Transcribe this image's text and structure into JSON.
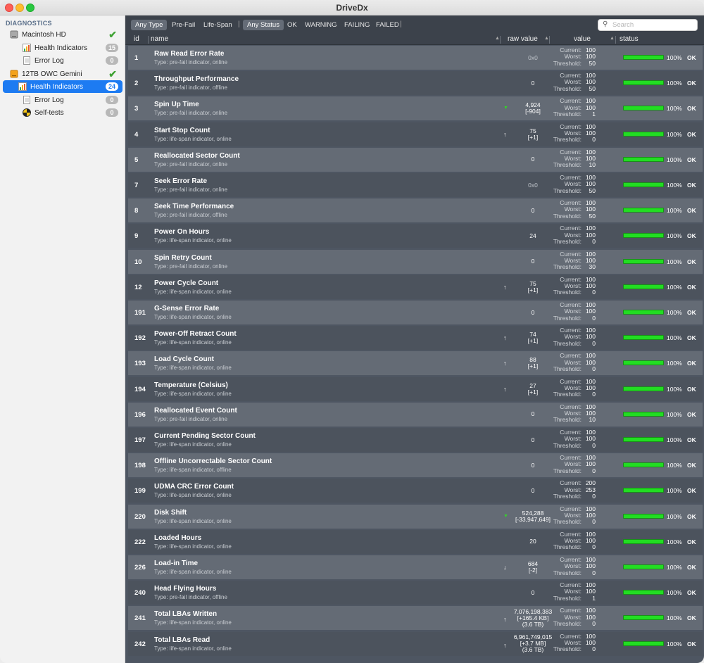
{
  "window": {
    "title": "DriveDx"
  },
  "sidebar": {
    "header": "DIAGNOSTICS",
    "items": [
      {
        "label": "Macintosh HD",
        "kind": "drive",
        "status": "ok"
      },
      {
        "label": "Health Indicators",
        "kind": "health",
        "badge": "15"
      },
      {
        "label": "Error Log",
        "kind": "log",
        "badge": "0"
      },
      {
        "label": "12TB OWC Gemini",
        "kind": "drive-orange",
        "status": "ok"
      },
      {
        "label": "Health Indicators",
        "kind": "health",
        "badge": "24",
        "selected": true
      },
      {
        "label": "Error Log",
        "kind": "log",
        "badge": "0"
      },
      {
        "label": "Self-tests",
        "kind": "selftest",
        "badge": "0"
      }
    ]
  },
  "filters": {
    "type": [
      "Any Type",
      "Pre-Fail",
      "Life-Span"
    ],
    "status": [
      "Any Status",
      "OK",
      "WARNING",
      "FAILING",
      "FAILED"
    ],
    "active_type": "Any Type",
    "active_status": "Any Status"
  },
  "search": {
    "placeholder": "Search"
  },
  "columns": {
    "id": "id",
    "name": "name",
    "raw": "raw value",
    "value": "value",
    "status": "status"
  },
  "value_labels": {
    "current": "Current:",
    "worst": "Worst:",
    "threshold": "Threshold:"
  },
  "colors": {
    "bar": "#22dd22",
    "row_light": "#646b75",
    "row_dark": "#4c535d",
    "selected": "#1d7bf2"
  },
  "rows": [
    {
      "id": "1",
      "name": "Raw Read Error Rate",
      "type": "Type: pre-fail indicator, online",
      "raw": [
        "0x0"
      ],
      "arrow": "",
      "current": "100",
      "worst": "100",
      "threshold": "50",
      "health": 100,
      "pct": "100%",
      "status": "OK"
    },
    {
      "id": "2",
      "name": "Throughput Performance",
      "type": "Type: pre-fail indicator, offline",
      "raw": [
        "0"
      ],
      "arrow": "",
      "current": "100",
      "worst": "100",
      "threshold": "50",
      "health": 100,
      "pct": "100%",
      "status": "OK"
    },
    {
      "id": "3",
      "name": "Spin Up Time",
      "type": "Type: pre-fail indicator, online",
      "raw": [
        "4,924",
        "[-904]"
      ],
      "arrow": "down-green",
      "current": "100",
      "worst": "100",
      "threshold": "1",
      "health": 100,
      "pct": "100%",
      "status": "OK"
    },
    {
      "id": "4",
      "name": "Start Stop Count",
      "type": "Type: life-span indicator, online",
      "raw": [
        "75",
        "[+1]"
      ],
      "arrow": "up",
      "current": "100",
      "worst": "100",
      "threshold": "0",
      "health": 100,
      "pct": "100%",
      "status": "OK"
    },
    {
      "id": "5",
      "name": "Reallocated Sector Count",
      "type": "Type: pre-fail indicator, online",
      "raw": [
        "0"
      ],
      "arrow": "",
      "current": "100",
      "worst": "100",
      "threshold": "10",
      "health": 100,
      "pct": "100%",
      "status": "OK"
    },
    {
      "id": "7",
      "name": "Seek Error Rate",
      "type": "Type: pre-fail indicator, online",
      "raw": [
        "0x0"
      ],
      "arrow": "",
      "current": "100",
      "worst": "100",
      "threshold": "50",
      "health": 100,
      "pct": "100%",
      "status": "OK"
    },
    {
      "id": "8",
      "name": "Seek Time Performance",
      "type": "Type: pre-fail indicator, offline",
      "raw": [
        "0"
      ],
      "arrow": "",
      "current": "100",
      "worst": "100",
      "threshold": "50",
      "health": 100,
      "pct": "100%",
      "status": "OK"
    },
    {
      "id": "9",
      "name": "Power On Hours",
      "type": "Type: life-span indicator, online",
      "raw": [
        "24"
      ],
      "arrow": "",
      "current": "100",
      "worst": "100",
      "threshold": "0",
      "health": 100,
      "pct": "100%",
      "status": "OK"
    },
    {
      "id": "10",
      "name": "Spin Retry Count",
      "type": "Type: pre-fail indicator, online",
      "raw": [
        "0"
      ],
      "arrow": "",
      "current": "100",
      "worst": "100",
      "threshold": "30",
      "health": 100,
      "pct": "100%",
      "status": "OK"
    },
    {
      "id": "12",
      "name": "Power Cycle Count",
      "type": "Type: life-span indicator, online",
      "raw": [
        "75",
        "[+1]"
      ],
      "arrow": "up",
      "current": "100",
      "worst": "100",
      "threshold": "0",
      "health": 100,
      "pct": "100%",
      "status": "OK"
    },
    {
      "id": "191",
      "name": "G-Sense Error Rate",
      "type": "Type: life-span indicator, online",
      "raw": [
        "0"
      ],
      "arrow": "",
      "current": "100",
      "worst": "100",
      "threshold": "0",
      "health": 100,
      "pct": "100%",
      "status": "OK"
    },
    {
      "id": "192",
      "name": "Power-Off Retract Count",
      "type": "Type: life-span indicator, online",
      "raw": [
        "74",
        "[+1]"
      ],
      "arrow": "up",
      "current": "100",
      "worst": "100",
      "threshold": "0",
      "health": 100,
      "pct": "100%",
      "status": "OK"
    },
    {
      "id": "193",
      "name": "Load Cycle Count",
      "type": "Type: life-span indicator, online",
      "raw": [
        "88",
        "[+1]"
      ],
      "arrow": "up",
      "current": "100",
      "worst": "100",
      "threshold": "0",
      "health": 100,
      "pct": "100%",
      "status": "OK"
    },
    {
      "id": "194",
      "name": "Temperature (Celsius)",
      "type": "Type: life-span indicator, online",
      "raw": [
        "27",
        "[+1]"
      ],
      "arrow": "up",
      "current": "100",
      "worst": "100",
      "threshold": "0",
      "health": 100,
      "pct": "100%",
      "status": "OK"
    },
    {
      "id": "196",
      "name": "Reallocated Event Count",
      "type": "Type: pre-fail indicator, online",
      "raw": [
        "0"
      ],
      "arrow": "",
      "current": "100",
      "worst": "100",
      "threshold": "10",
      "health": 100,
      "pct": "100%",
      "status": "OK"
    },
    {
      "id": "197",
      "name": "Current Pending Sector Count",
      "type": "Type: life-span indicator, online",
      "raw": [
        "0"
      ],
      "arrow": "",
      "current": "100",
      "worst": "100",
      "threshold": "0",
      "health": 100,
      "pct": "100%",
      "status": "OK"
    },
    {
      "id": "198",
      "name": "Offline Uncorrectable Sector Count",
      "type": "Type: life-span indicator, offline",
      "raw": [
        "0"
      ],
      "arrow": "",
      "current": "100",
      "worst": "100",
      "threshold": "0",
      "health": 100,
      "pct": "100%",
      "status": "OK"
    },
    {
      "id": "199",
      "name": "UDMA CRC Error Count",
      "type": "Type: life-span indicator, online",
      "raw": [
        "0"
      ],
      "arrow": "",
      "current": "200",
      "worst": "253",
      "threshold": "0",
      "health": 100,
      "pct": "100%",
      "status": "OK"
    },
    {
      "id": "220",
      "name": "Disk Shift",
      "type": "Type: life-span indicator, online",
      "raw": [
        "524,288",
        "[-33,947,649]"
      ],
      "arrow": "down-green",
      "current": "100",
      "worst": "100",
      "threshold": "0",
      "health": 100,
      "pct": "100%",
      "status": "OK"
    },
    {
      "id": "222",
      "name": "Loaded Hours",
      "type": "Type: life-span indicator, online",
      "raw": [
        "20"
      ],
      "arrow": "",
      "current": "100",
      "worst": "100",
      "threshold": "0",
      "health": 100,
      "pct": "100%",
      "status": "OK"
    },
    {
      "id": "226",
      "name": "Load-in Time",
      "type": "Type: life-span indicator, online",
      "raw": [
        "684",
        "[-2]"
      ],
      "arrow": "down",
      "current": "100",
      "worst": "100",
      "threshold": "0",
      "health": 100,
      "pct": "100%",
      "status": "OK"
    },
    {
      "id": "240",
      "name": "Head Flying Hours",
      "type": "Type: pre-fail indicator, offline",
      "raw": [
        "0"
      ],
      "arrow": "",
      "current": "100",
      "worst": "100",
      "threshold": "1",
      "health": 100,
      "pct": "100%",
      "status": "OK"
    },
    {
      "id": "241",
      "name": "Total LBAs Written",
      "type": "Type: life-span indicator, online",
      "raw": [
        "7,076,198,383",
        "[+165.4 KB]",
        "(3.6 TB)"
      ],
      "arrow": "up",
      "current": "100",
      "worst": "100",
      "threshold": "0",
      "health": 100,
      "pct": "100%",
      "status": "OK"
    },
    {
      "id": "242",
      "name": "Total LBAs Read",
      "type": "Type: life-span indicator, online",
      "raw": [
        "6,961,749,015",
        "[+3.7 MB]",
        "(3.6 TB)"
      ],
      "arrow": "up",
      "current": "100",
      "worst": "100",
      "threshold": "0",
      "health": 100,
      "pct": "100%",
      "status": "OK"
    }
  ]
}
